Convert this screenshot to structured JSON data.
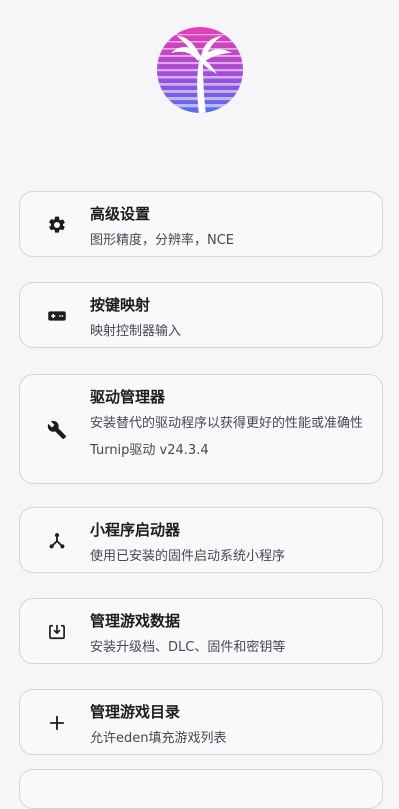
{
  "logo": "palm-tree-sunset-logo",
  "items": [
    {
      "icon": "gear-icon",
      "title": "高级设置",
      "description": "图形精度，分辨率，NCE"
    },
    {
      "icon": "gamepad-icon",
      "title": "按键映射",
      "description": "映射控制器输入"
    },
    {
      "icon": "wrench-icon",
      "title": "驱动管理器",
      "description": "安装替代的驱动程序以获得更好的性能或准确性",
      "extra": "Turnip驱动  v24.3.4"
    },
    {
      "icon": "applet-launcher-icon",
      "title": "小程序启动器",
      "description": "使用已安装的固件启动系统小程序"
    },
    {
      "icon": "download-box-icon",
      "title": "管理游戏数据",
      "description": "安装升级档、DLC、固件和密钥等"
    },
    {
      "icon": "plus-icon",
      "title": "管理游戏目录",
      "description": "允许eden填充游戏列表"
    }
  ],
  "colors": {
    "logo_top": "#e83fb0",
    "logo_middle": "#a54bd8",
    "logo_bottom": "#4f73f0",
    "card_border": "#d6d3da",
    "background": "#f6f5f7",
    "text_primary": "#1d1b1f",
    "text_secondary": "#4a4650"
  }
}
